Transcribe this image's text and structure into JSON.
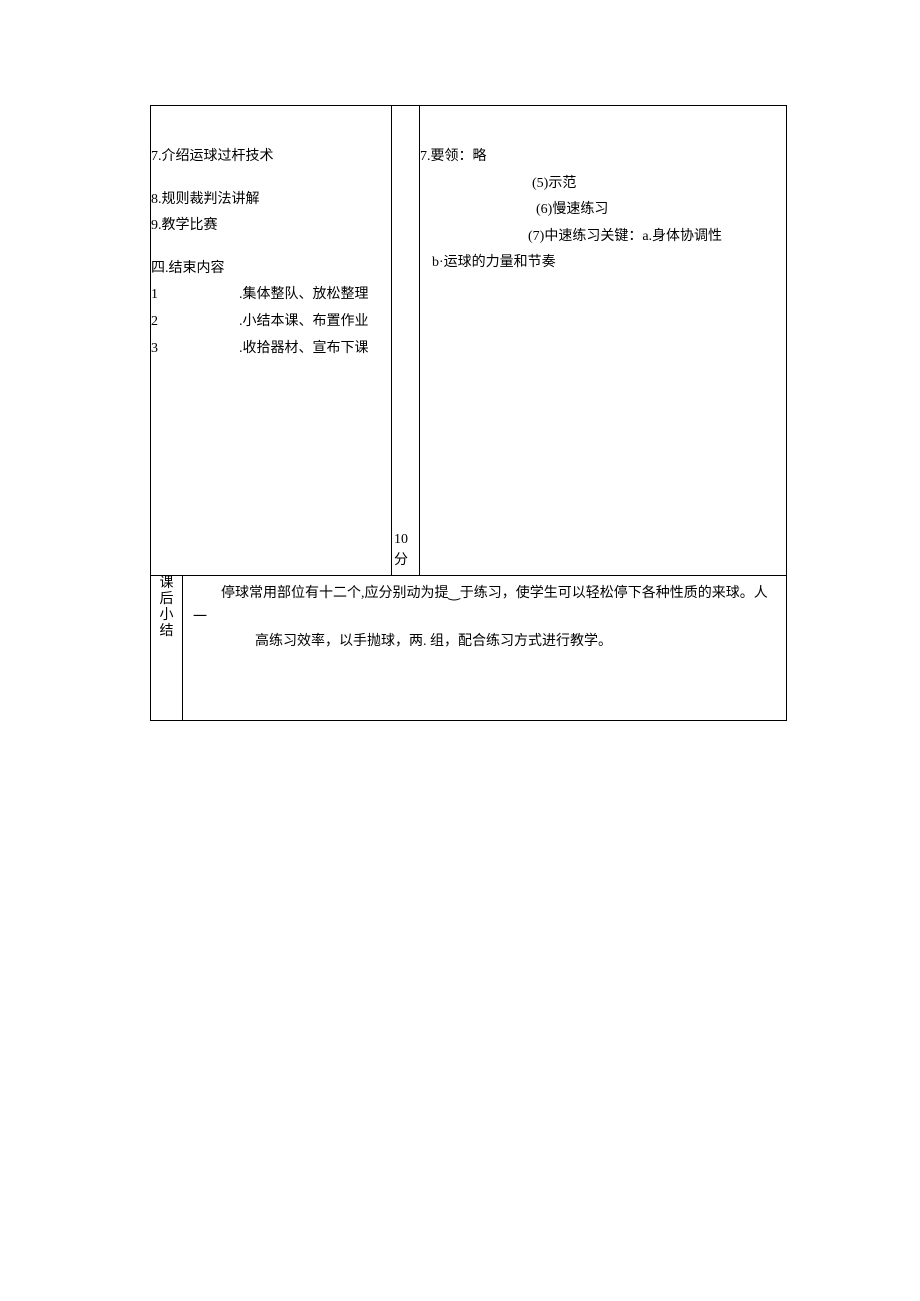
{
  "left": {
    "item7": "7.介绍运球过杆技术",
    "item8": "8.规则裁判法讲解",
    "item9": "9.教学比赛",
    "section4": "四.结束内容",
    "sub1_num": "1",
    "sub1_text": ".集体整队、放松整理",
    "sub2_num": "2",
    "sub2_text": ".小结本课、布置作业",
    "sub3_num": "3",
    "sub3_text": ".收拾器材、宣布下课"
  },
  "mid": {
    "time_num": "10",
    "time_unit": "分"
  },
  "right": {
    "item7": "7.要领：略",
    "sub5": "(5)示范",
    "sub6": "(6)慢速练习",
    "sub7": "(7)中速练习关键：a.身体协调性",
    "subB": "b·运球的力量和节奏"
  },
  "row2": {
    "label": "课后小结",
    "summary_line1": "停球常用部位有十二个，应分别动为提高练习效率，以手抛球，两、于练习，使学生可以轻松停下各种性质的来球。人一组，配合练习方式进行教学。"
  },
  "summary_display": {
    "line1": "停球常用部位有十二个,应分别动为提‿于练习，使学生可以轻松停下各种性质的来球。人一",
    "line2": "高练习效率，以手抛球，两.  组，配合练习方式进行教学。"
  }
}
